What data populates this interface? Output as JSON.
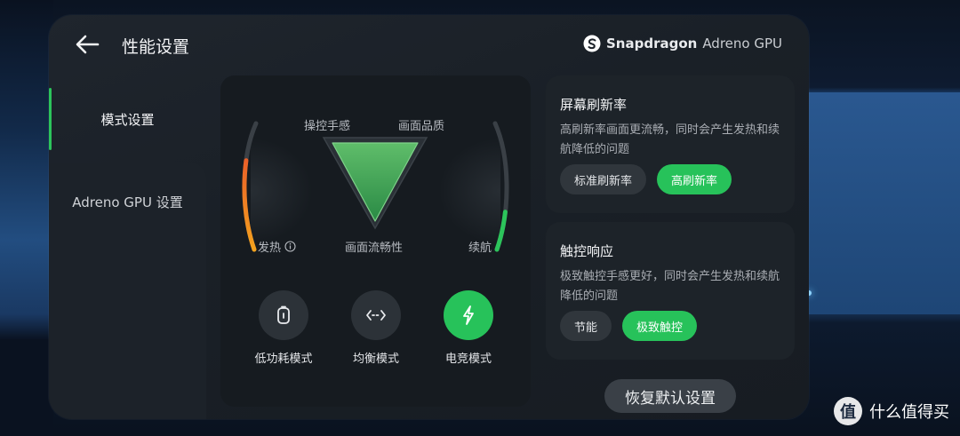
{
  "header": {
    "title": "性能设置",
    "brand_name": "Snapdragon",
    "brand_product": "Adreno GPU"
  },
  "sidebar": {
    "items": [
      {
        "label": "模式设置",
        "active": true
      },
      {
        "label": "Adreno GPU 设置",
        "active": false
      }
    ]
  },
  "mode_panel": {
    "labels": {
      "control": "操控手感",
      "quality": "画面品质",
      "heat": "发热",
      "fluency": "画面流畅性",
      "battery": "续航"
    },
    "heat_level": 0.7,
    "battery_level": 0.3,
    "modes": [
      {
        "label": "低功耗模式",
        "icon": "battery-saver-icon",
        "active": false
      },
      {
        "label": "均衡模式",
        "icon": "balance-arrows-icon",
        "active": false
      },
      {
        "label": "电竞模式",
        "icon": "lightning-icon",
        "active": true
      }
    ]
  },
  "refresh_card": {
    "title": "屏幕刷新率",
    "desc": "高刷新率画面更流畅，同时会产生发热和续航降低的问题",
    "options": [
      {
        "label": "标准刷新率",
        "active": false
      },
      {
        "label": "高刷新率",
        "active": true
      }
    ]
  },
  "touch_card": {
    "title": "触控响应",
    "desc": "极致触控手感更好，同时会产生发热和续航降低的问题",
    "options": [
      {
        "label": "节能",
        "active": false
      },
      {
        "label": "极致触控",
        "active": true
      }
    ]
  },
  "reset_label": "恢复默认设置",
  "watermark": {
    "badge": "值",
    "text": "什么值得买"
  },
  "colors": {
    "accent": "#27c25a",
    "panel": "#1a2027",
    "card": "#1d2329"
  }
}
